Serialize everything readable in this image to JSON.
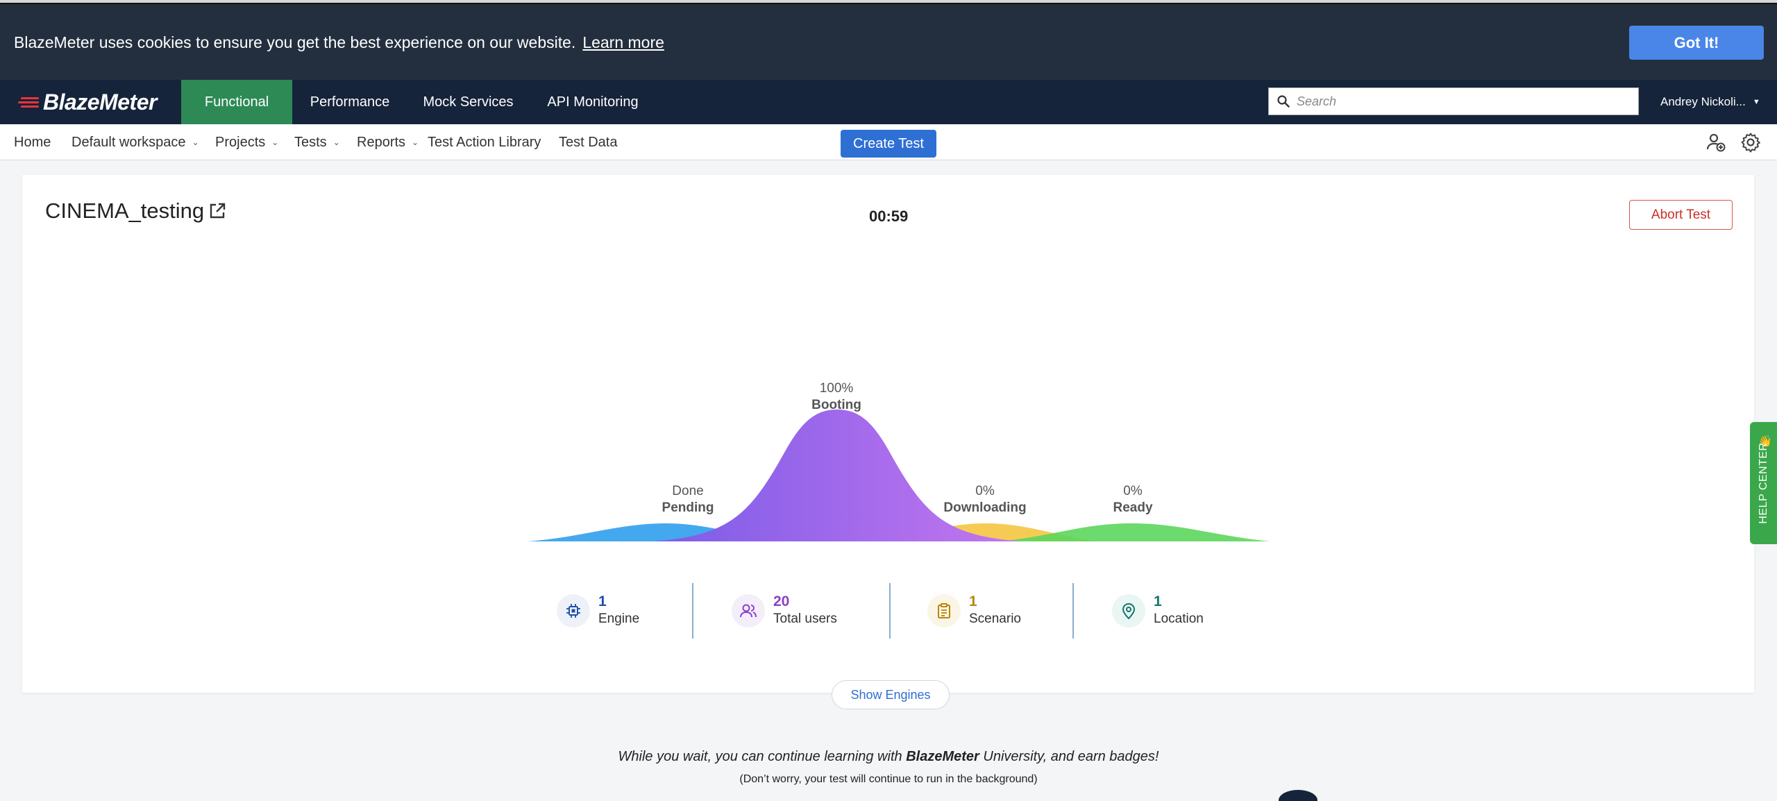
{
  "cookie": {
    "message": "BlazeMeter uses cookies to ensure you get the best experience on our website.",
    "learn_more": "Learn more",
    "accept": "Got It!"
  },
  "nav": {
    "logo": "BlazeMeter",
    "tabs": [
      {
        "label": "Functional",
        "active": true
      },
      {
        "label": "Performance",
        "active": false
      },
      {
        "label": "Mock Services",
        "active": false
      },
      {
        "label": "API Monitoring",
        "active": false
      }
    ],
    "search_placeholder": "Search",
    "user": "Andrey Nickoli..."
  },
  "subnav": {
    "home": "Home",
    "workspace": "Default workspace",
    "projects": "Projects",
    "tests": "Tests",
    "reports": "Reports",
    "action_library": "Test Action Library",
    "test_data": "Test Data",
    "create_test": "Create Test"
  },
  "test": {
    "name": "CINEMA_testing",
    "timer": "00:59",
    "abort": "Abort Test"
  },
  "progress": {
    "stages": [
      {
        "status": "Done",
        "name": "Pending",
        "color": "#3aa3ee"
      },
      {
        "status": "100%",
        "name": "Booting",
        "color": "#9a5cf0"
      },
      {
        "status": "0%",
        "name": "Downloading",
        "color": "#f5c542"
      },
      {
        "status": "0%",
        "name": "Ready",
        "color": "#5cd65c"
      }
    ]
  },
  "stats": [
    {
      "value": "1",
      "label": "Engine",
      "color": "#1d4fa8",
      "icon": "engine-icon"
    },
    {
      "value": "20",
      "label": "Total users",
      "color": "#8a3fc9",
      "icon": "users-icon"
    },
    {
      "value": "1",
      "label": "Scenario",
      "color": "#b8860b",
      "icon": "clipboard-icon"
    },
    {
      "value": "1",
      "label": "Location",
      "color": "#14756b",
      "icon": "location-pin-icon"
    }
  ],
  "show_engines": "Show Engines",
  "learning": {
    "pre": "While you wait, you can continue learning with",
    "brand": "BlazeMeter",
    "post": "University, and earn badges!",
    "note": "(Don’t worry, your test will continue to run in the background)"
  },
  "help_center": "HELP CENTER"
}
